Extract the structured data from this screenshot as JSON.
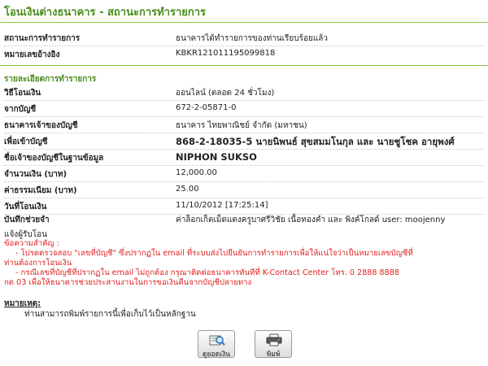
{
  "page_title": "โอนเงินต่างธนาคาร - สถานะการทำรายการ",
  "status": {
    "label": "สถานะการทำรายการ",
    "value": "ธนาคารได้ทำรายการของท่านเรียบร้อยแล้ว"
  },
  "reference": {
    "label": "หมายเลขอ้างอิง",
    "value": "KBKR121011195099818"
  },
  "details_title": "รายละเอียดการทำรายการ",
  "details": {
    "method_label": "วิธีโอนเงิน",
    "method_value": "ออนไลน์ (ตลอด 24 ชั่วโมง)",
    "from_label": "จากบัญชี",
    "from_value": "672-2-05871-0",
    "bank_label": "ธนาคารเจ้าของบัญชี",
    "bank_value": "ธนาคาร ไทยพาณิชย์ จำกัด (มหาชน)",
    "to_label": "เพื่อเข้าบัญชี",
    "to_value": "868-2-18035-5 นายนิพนธ์ สุขสมมโนกุล และ นายชูโชค อายุพงศ์",
    "owner_label": "ชื่อเจ้าของบัญชีในฐานข้อมูล",
    "owner_value": "NIPHON SUKSO",
    "amount_label": "จำนวนเงิน (บาท)",
    "amount_value": "12,000.00",
    "fee_label": "ค่าธรรมเนียม (บาท)",
    "fee_value": "25.00",
    "date_label": "วันที่โอนเงิน",
    "date_value": "11/10/2012 [17:25:14]",
    "memo_label": "บันทึกช่วยจำ",
    "memo_value": "ค่าล็อกเก็ตเม็ดแตงครูบาศรีวิชัย เนื้อทองคำ และ พิงค์โกลด์ user: moojenny"
  },
  "notify_label": "แจ้งผู้รับโอน",
  "important": {
    "title": "ข้อความสำคัญ :",
    "line1": "- โปรดตรวจสอบ \"เลขที่บัญชี\" ซึ่งปรากฏใน email ที่ระบบส่งไปยืนยันการทำรายการเพื่อให้แน่ใจว่าเป็นหมายเลขบัญชีที่",
    "line2": "ท่านต้องการโอนเงิน",
    "line3": "- กรณีเลขที่บัญชีที่ปรากฏใน email ไม่ถูกต้อง กรุณาติดต่อธนาคารทันทีที่ K-Contact Center โทร. 0 2888 8888",
    "line4": "กด 03 เพื่อให้ธนาคารช่วยประสานงานในการขอเงินคืนจากบัญชีปลายทาง"
  },
  "remark": {
    "title": "หมายเหตุ:",
    "text": "ท่านสามารถพิมพ์รายการนี้เพื่อเก็บไว้เป็นหลักฐาน"
  },
  "buttons": {
    "check_balance": "ดูยอดเงิน",
    "print": "พิมพ์"
  },
  "colors": {
    "brand_green": "#4a8c1c",
    "rule_green": "#8cc63f",
    "alert_red": "#e02020"
  }
}
